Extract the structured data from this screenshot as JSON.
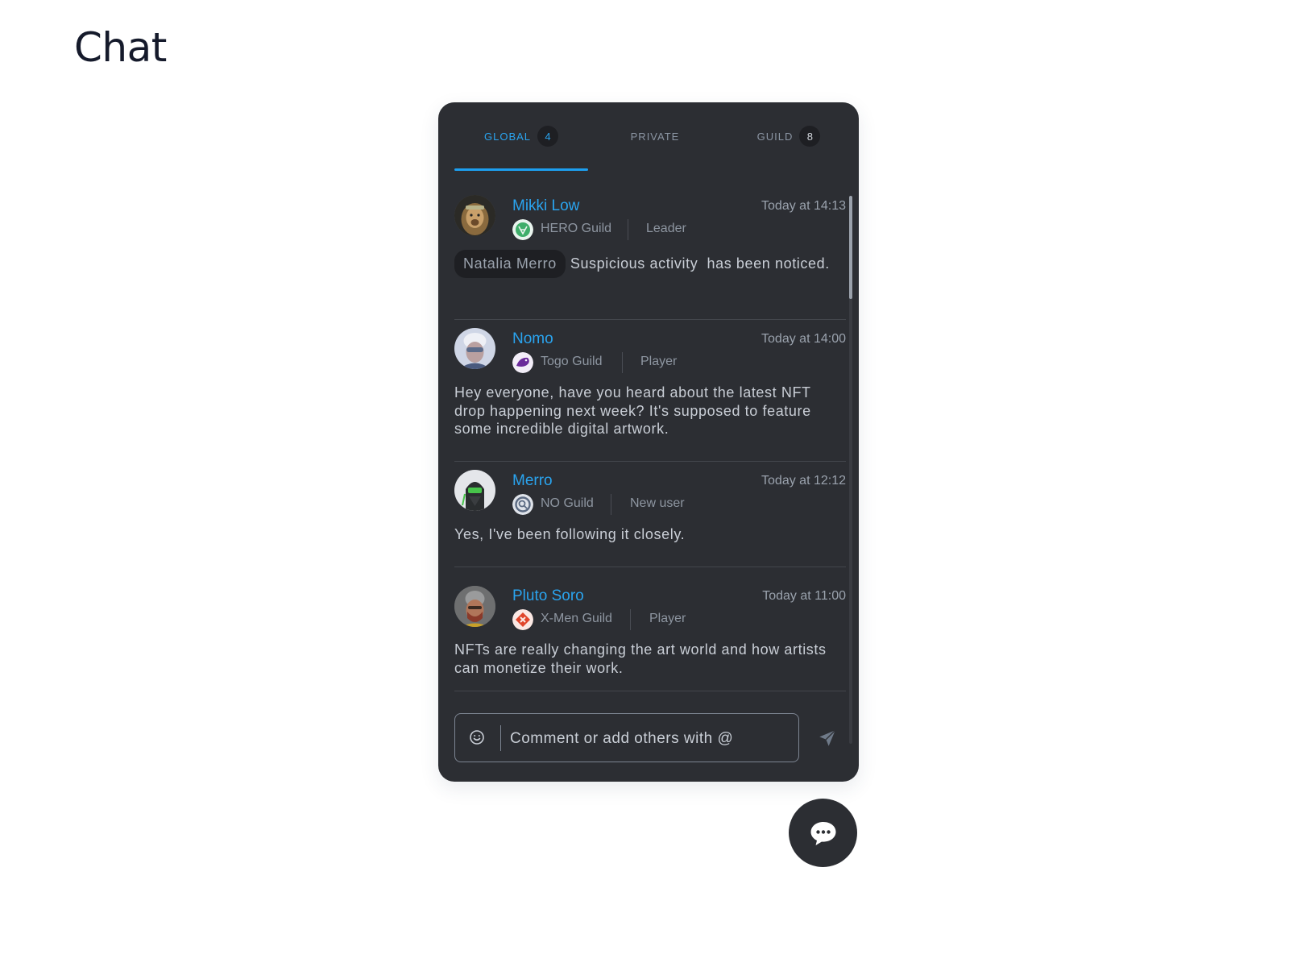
{
  "page": {
    "title": "Chat"
  },
  "tabs": [
    {
      "label": "GLOBAL",
      "badge": "4"
    },
    {
      "label": "PRIVATE"
    },
    {
      "label": "GUILD",
      "badge": "8"
    }
  ],
  "colors": {
    "accent": "#2aa4ef",
    "panel_bg": "#2c2e33",
    "badge_bg": "#1e1f23",
    "text_primary": "#c9ced6",
    "text_muted": "#8e96a1"
  },
  "messages": [
    {
      "name": "Mikki Low",
      "time": "Today at 14:13",
      "guild": "HERO Guild",
      "guild_icon": "hero-guild-emblem-icon",
      "role": "Leader",
      "mention": "Natalia Merro",
      "text": "Suspicious activity  has been noticed."
    },
    {
      "name": "Nomo",
      "time": "Today at 14:00",
      "guild": "Togo Guild",
      "guild_icon": "togo-guild-emblem-icon",
      "role": "Player",
      "text": "Hey everyone, have you heard about the latest NFT drop happening next week? It's supposed to feature some incredible digital artwork."
    },
    {
      "name": "Merro",
      "time": "Today at 12:12",
      "guild": "NO Guild",
      "guild_icon": "no-guild-emblem-icon",
      "role": "New user",
      "text": "Yes, I've been following it closely."
    },
    {
      "name": "Pluto Soro",
      "time": "Today at 11:00",
      "guild": "X-Men Guild",
      "guild_icon": "xmen-guild-emblem-icon",
      "role": "Player",
      "text": "NFTs are really changing the art world and how artists can monetize their work."
    }
  ],
  "composer": {
    "placeholder": "Comment or add others with @",
    "emoji_icon": "smiley-icon",
    "send_icon": "send-arrow-icon"
  },
  "fab": {
    "icon": "chat-bubble-icon"
  }
}
